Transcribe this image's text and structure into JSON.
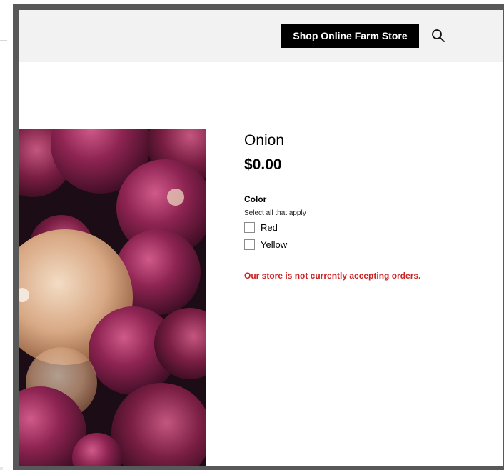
{
  "header": {
    "shop_button_label": "Shop Online Farm Store",
    "search_icon": "search-icon"
  },
  "product": {
    "image_subject": "red and yellow onions",
    "title": "Onion",
    "price": "$0.00",
    "option_group": {
      "label": "Color",
      "help": "Select all that apply",
      "options": [
        {
          "label": "Red",
          "checked": false
        },
        {
          "label": "Yellow",
          "checked": false
        }
      ]
    },
    "notice": "Our store is not currently accepting orders."
  },
  "colors": {
    "header_bg": "#f2f2f2",
    "button_bg": "#000000",
    "notice": "#cc2222",
    "frame": "#585858"
  }
}
